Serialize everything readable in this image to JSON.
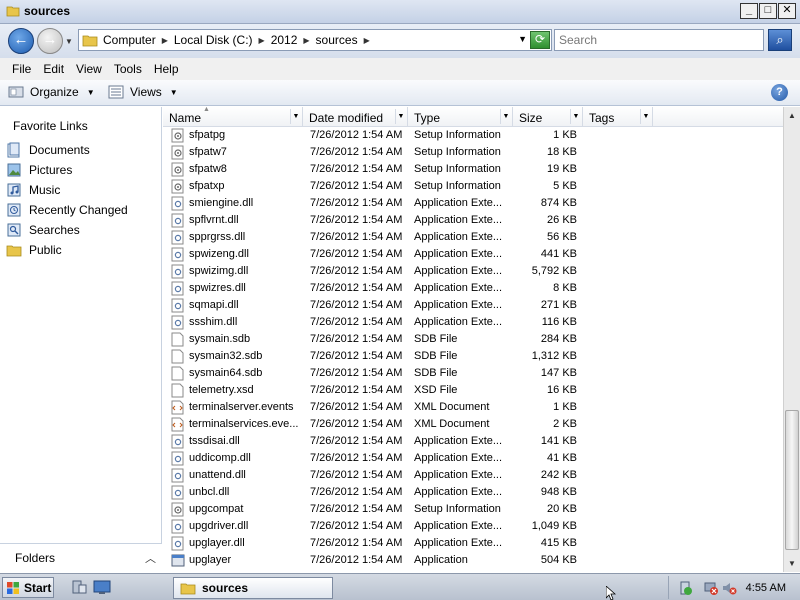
{
  "window": {
    "title": "sources"
  },
  "address": {
    "crumbs": [
      "Computer",
      "Local Disk (C:)",
      "2012",
      "sources"
    ],
    "search_placeholder": "Search"
  },
  "menu": [
    "File",
    "Edit",
    "View",
    "Tools",
    "Help"
  ],
  "toolbar": {
    "organize_label": "Organize",
    "views_label": "Views"
  },
  "sidebar": {
    "heading": "Favorite Links",
    "items": [
      {
        "label": "Documents",
        "icon": "documents-icon"
      },
      {
        "label": "Pictures",
        "icon": "pictures-icon"
      },
      {
        "label": "Music",
        "icon": "music-icon"
      },
      {
        "label": "Recently Changed",
        "icon": "recently-changed-icon"
      },
      {
        "label": "Searches",
        "icon": "searches-icon"
      },
      {
        "label": "Public",
        "icon": "public-folder-icon"
      }
    ],
    "folders_label": "Folders"
  },
  "columns": {
    "name": "Name",
    "date": "Date modified",
    "type": "Type",
    "size": "Size",
    "tags": "Tags"
  },
  "files": [
    {
      "name": "sfpatpg",
      "date": "7/26/2012 1:54 AM",
      "type": "Setup Information",
      "size": "1 KB",
      "icon": "setup"
    },
    {
      "name": "sfpatw7",
      "date": "7/26/2012 1:54 AM",
      "type": "Setup Information",
      "size": "18 KB",
      "icon": "setup"
    },
    {
      "name": "sfpatw8",
      "date": "7/26/2012 1:54 AM",
      "type": "Setup Information",
      "size": "19 KB",
      "icon": "setup"
    },
    {
      "name": "sfpatxp",
      "date": "7/26/2012 1:54 AM",
      "type": "Setup Information",
      "size": "5 KB",
      "icon": "setup"
    },
    {
      "name": "smiengine.dll",
      "date": "7/26/2012 1:54 AM",
      "type": "Application Exte...",
      "size": "874 KB",
      "icon": "dll"
    },
    {
      "name": "spflvrnt.dll",
      "date": "7/26/2012 1:54 AM",
      "type": "Application Exte...",
      "size": "26 KB",
      "icon": "dll"
    },
    {
      "name": "spprgrss.dll",
      "date": "7/26/2012 1:54 AM",
      "type": "Application Exte...",
      "size": "56 KB",
      "icon": "dll"
    },
    {
      "name": "spwizeng.dll",
      "date": "7/26/2012 1:54 AM",
      "type": "Application Exte...",
      "size": "441 KB",
      "icon": "dll"
    },
    {
      "name": "spwizimg.dll",
      "date": "7/26/2012 1:54 AM",
      "type": "Application Exte...",
      "size": "5,792 KB",
      "icon": "dll"
    },
    {
      "name": "spwizres.dll",
      "date": "7/26/2012 1:54 AM",
      "type": "Application Exte...",
      "size": "8 KB",
      "icon": "dll"
    },
    {
      "name": "sqmapi.dll",
      "date": "7/26/2012 1:54 AM",
      "type": "Application Exte...",
      "size": "271 KB",
      "icon": "dll"
    },
    {
      "name": "ssshim.dll",
      "date": "7/26/2012 1:54 AM",
      "type": "Application Exte...",
      "size": "116 KB",
      "icon": "dll"
    },
    {
      "name": "sysmain.sdb",
      "date": "7/26/2012 1:54 AM",
      "type": "SDB File",
      "size": "284 KB",
      "icon": "blank"
    },
    {
      "name": "sysmain32.sdb",
      "date": "7/26/2012 1:54 AM",
      "type": "SDB File",
      "size": "1,312 KB",
      "icon": "blank"
    },
    {
      "name": "sysmain64.sdb",
      "date": "7/26/2012 1:54 AM",
      "type": "SDB File",
      "size": "147 KB",
      "icon": "blank"
    },
    {
      "name": "telemetry.xsd",
      "date": "7/26/2012 1:54 AM",
      "type": "XSD File",
      "size": "16 KB",
      "icon": "blank"
    },
    {
      "name": "terminalserver.events",
      "date": "7/26/2012 1:54 AM",
      "type": "XML Document",
      "size": "1 KB",
      "icon": "xml"
    },
    {
      "name": "terminalservices.eve...",
      "date": "7/26/2012 1:54 AM",
      "type": "XML Document",
      "size": "2 KB",
      "icon": "xml"
    },
    {
      "name": "tssdisai.dll",
      "date": "7/26/2012 1:54 AM",
      "type": "Application Exte...",
      "size": "141 KB",
      "icon": "dll"
    },
    {
      "name": "uddicomp.dll",
      "date": "7/26/2012 1:54 AM",
      "type": "Application Exte...",
      "size": "41 KB",
      "icon": "dll"
    },
    {
      "name": "unattend.dll",
      "date": "7/26/2012 1:54 AM",
      "type": "Application Exte...",
      "size": "242 KB",
      "icon": "dll"
    },
    {
      "name": "unbcl.dll",
      "date": "7/26/2012 1:54 AM",
      "type": "Application Exte...",
      "size": "948 KB",
      "icon": "dll"
    },
    {
      "name": "upgcompat",
      "date": "7/26/2012 1:54 AM",
      "type": "Setup Information",
      "size": "20 KB",
      "icon": "setup"
    },
    {
      "name": "upgdriver.dll",
      "date": "7/26/2012 1:54 AM",
      "type": "Application Exte...",
      "size": "1,049 KB",
      "icon": "dll"
    },
    {
      "name": "upglayer.dll",
      "date": "7/26/2012 1:54 AM",
      "type": "Application Exte...",
      "size": "415 KB",
      "icon": "dll"
    },
    {
      "name": "upglayer",
      "date": "7/26/2012 1:54 AM",
      "type": "Application",
      "size": "504 KB",
      "icon": "app"
    }
  ],
  "taskbar": {
    "start_label": "Start",
    "task_label": "sources",
    "clock": "4:55 AM"
  }
}
